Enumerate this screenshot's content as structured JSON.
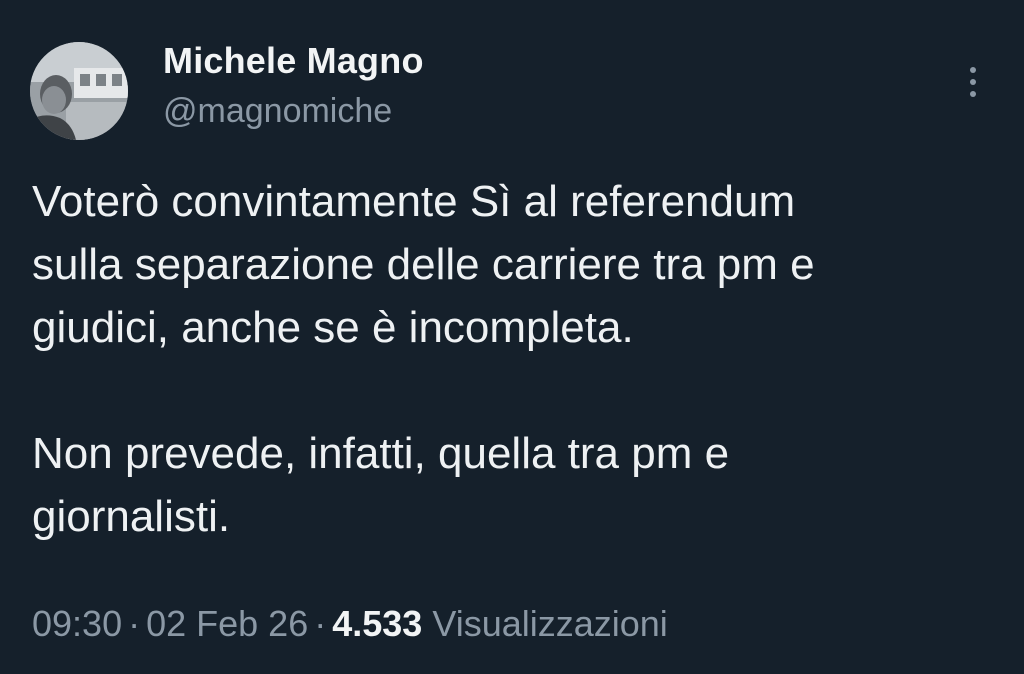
{
  "author": {
    "display_name": "Michele Magno",
    "handle": "@magnomiche"
  },
  "tweet": {
    "paragraphs": [
      "Voterò convintamente Sì al referendum\nsulla separazione delle carriere tra pm e\ngiudici, anche se è incompleta.",
      "Non prevede, infatti, quella tra pm e\ngiornalisti."
    ]
  },
  "meta": {
    "time": "09:30",
    "date": "02 Feb 26",
    "separator": "·",
    "views_count": "4.533",
    "views_label": "Visualizzazioni"
  },
  "icons": {
    "more": "more-options-icon",
    "avatar": "profile-photo"
  },
  "colors": {
    "background": "#15202b",
    "primary_text": "#e7e9ea",
    "secondary_text": "#8b98a5"
  }
}
